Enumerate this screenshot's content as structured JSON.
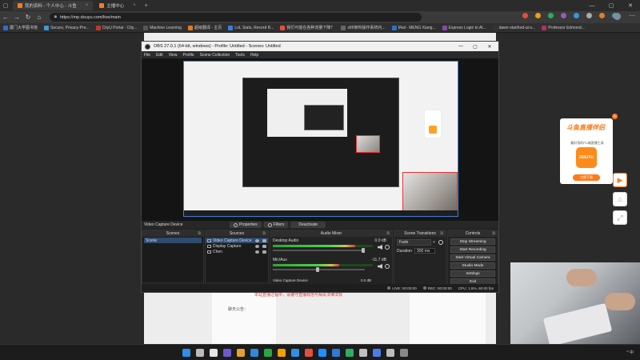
{
  "browser": {
    "tabs": [
      {
        "title": "我的资料 - 个人中心 - 斗鱼",
        "active": true
      },
      {
        "title": "主播中心",
        "active": false
      }
    ],
    "url": "https://mp.douyu.com/live/main",
    "bookmarks": [
      {
        "label": "厦门大学图书馆",
        "color": "#2b6cd9"
      },
      {
        "label": "Secure, Privacy-Pre...",
        "color": "#3a9ad9"
      },
      {
        "label": "CityU Portal - City...",
        "color": "#c0392b"
      },
      {
        "label": "Machine Learning",
        "color": "#555"
      },
      {
        "label": "超级翻译 - 主页",
        "color": "#e07b22"
      },
      {
        "label": "LoL Stats, Record R...",
        "color": "#3b7dd8"
      },
      {
        "label": "我们可能在各种流量下降？",
        "color": "#e74c3c"
      },
      {
        "label": "x86架构操作系统内...",
        "color": "#666"
      },
      {
        "label": "Mail - MENG Xiang...",
        "color": "#2a72c9"
      },
      {
        "label": "Express Login to Al...",
        "color": "#8e44ad"
      },
      {
        "label": "dawn-stanford-ai-s...",
        "color": "#333"
      },
      {
        "label": "Professor Edmond...",
        "color": "#b03060"
      }
    ],
    "ext_colors": [
      "#e74c3c",
      "#f39c12",
      "#27ae60",
      "#9b59b6",
      "#3498db",
      "#aaa",
      "#e67e22",
      "#1abc9c"
    ]
  },
  "page": {
    "note": "聊天公告：",
    "red_text": "本站直播过程中，请遵守直播规范与相关法律法规"
  },
  "ad": {
    "title": "斗鱼直播伴侣",
    "subtitle": "最好用的PC端直播工具",
    "logo_text": "DOUYU",
    "button": "立即下载",
    "close": "×"
  },
  "obs": {
    "title": "OBS 27.0.1 (64-bit, windows) - Profile: Untitled - Scenes: Untitled",
    "menu": [
      "File",
      "Edit",
      "View",
      "Profile",
      "Scene Collection",
      "Tools",
      "Help"
    ],
    "source_name": "Video Capture Device",
    "strip_buttons": [
      "Properties",
      "Filters",
      "Deactivate"
    ],
    "docks": {
      "scenes": "Scenes",
      "sources": "Sources",
      "mixer": "Audio Mixer",
      "transitions": "Scene Transitions",
      "controls": "Controls"
    },
    "scenes": [
      "Scene"
    ],
    "sources": [
      "Video Capture Device",
      "Display Capture",
      "Chen"
    ],
    "mixer": [
      {
        "name": "Desktop Audio",
        "db": "0.0 dB",
        "level": 0.82,
        "fader": 1.0
      },
      {
        "name": "Mic/Aux",
        "db": "-11.7 dB",
        "level": 0.66,
        "fader": 0.5
      }
    ],
    "mixer_last": {
      "name": "Video Capture Device",
      "db": "0.0 dB"
    },
    "transition": {
      "type": "Fade",
      "duration_label": "Duration",
      "duration": "300 ms"
    },
    "controls": [
      "Stop Streaming",
      "Start Recording",
      "Start Virtual Camera",
      "Studio Mode",
      "Settings",
      "Exit"
    ],
    "status": {
      "live": "LIVE: 00:00:00",
      "rec": "REC: 00:00:00",
      "cpu": "CPU: 1.6%, 60.00 fps"
    }
  },
  "taskbar": {
    "icon_colors": [
      "#2f8fe8",
      "#bbb",
      "#e6e6e6",
      "#6b5acd",
      "#e5a02e",
      "#2e8bd9",
      "#28a745",
      "#f0a000",
      "#2f8fe8",
      "#e74c3c",
      "#1e90ff",
      "#2e7ad8",
      "#2aae67",
      "#c0c0c0",
      "#4b7bec",
      "#bbb",
      "#888"
    ],
    "time": "^ 中"
  }
}
